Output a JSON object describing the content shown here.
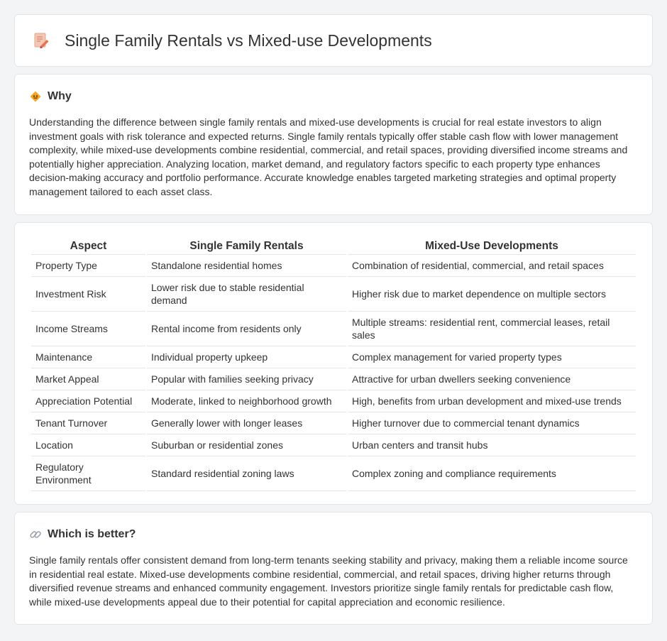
{
  "header": {
    "title": "Single Family Rentals vs Mixed-use Developments",
    "icon": "document-pencil-icon"
  },
  "why": {
    "title": "Why",
    "icon": "bulb-icon",
    "text": "Understanding the difference between single family rentals and mixed-use developments is crucial for real estate investors to align investment goals with risk tolerance and expected returns. Single family rentals typically offer stable cash flow with lower management complexity, while mixed-use developments combine residential, commercial, and retail spaces, providing diversified income streams and potentially higher appreciation. Analyzing location, market demand, and regulatory factors specific to each property type enhances decision-making accuracy and portfolio performance. Accurate knowledge enables targeted marketing strategies and optimal property management tailored to each asset class."
  },
  "table": {
    "headers": [
      "Aspect",
      "Single Family Rentals",
      "Mixed-Use Developments"
    ],
    "rows": [
      [
        "Property Type",
        "Standalone residential homes",
        "Combination of residential, commercial, and retail spaces"
      ],
      [
        "Investment Risk",
        "Lower risk due to stable residential demand",
        "Higher risk due to market dependence on multiple sectors"
      ],
      [
        "Income Streams",
        "Rental income from residents only",
        "Multiple streams: residential rent, commercial leases, retail sales"
      ],
      [
        "Maintenance",
        "Individual property upkeep",
        "Complex management for varied property types"
      ],
      [
        "Market Appeal",
        "Popular with families seeking privacy",
        "Attractive for urban dwellers seeking convenience"
      ],
      [
        "Appreciation Potential",
        "Moderate, linked to neighborhood growth",
        "High, benefits from urban development and mixed-use trends"
      ],
      [
        "Tenant Turnover",
        "Generally lower with longer leases",
        "Higher turnover due to commercial tenant dynamics"
      ],
      [
        "Location",
        "Suburban or residential zones",
        "Urban centers and transit hubs"
      ],
      [
        "Regulatory Environment",
        "Standard residential zoning laws",
        "Complex zoning and compliance requirements"
      ]
    ]
  },
  "better": {
    "title": "Which is better?",
    "icon": "link-icon",
    "text": "Single family rentals offer consistent demand from long-term tenants seeking stability and privacy, making them a reliable income source in residential real estate. Mixed-use developments combine residential, commercial, and retail spaces, driving higher returns through diversified revenue streams and enhanced community engagement. Investors prioritize single family rentals for predictable cash flow, while mixed-use developments appeal due to their potential for capital appreciation and economic resilience."
  }
}
